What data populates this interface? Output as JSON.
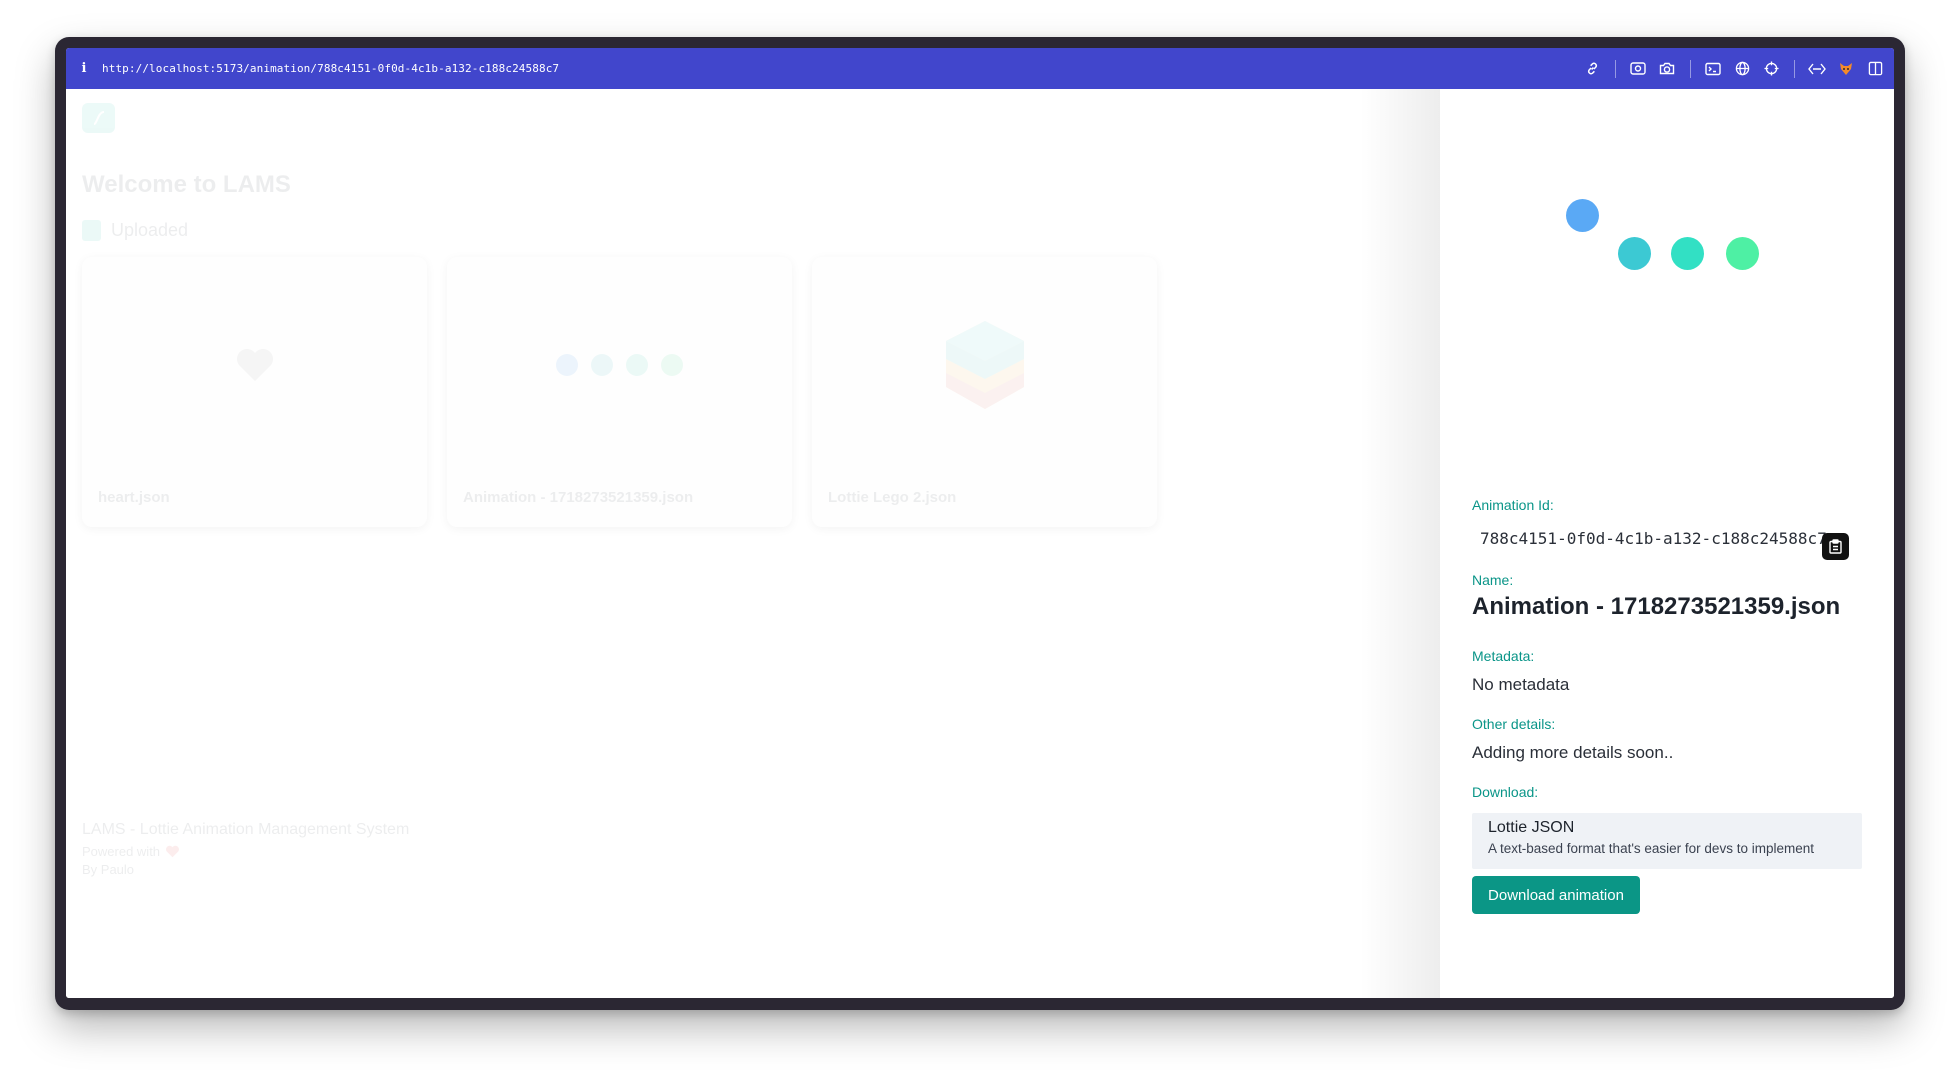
{
  "browser": {
    "info_glyph": "i",
    "url": "http://localhost:5173/animation/788c4151-0f0d-4c1b-a132-c188c24588c7"
  },
  "background_page": {
    "title": "Welcome to LAMS",
    "section_label": "Uploaded",
    "cards": [
      {
        "filename": "heart.json",
        "preview": "heart"
      },
      {
        "filename": "Animation - 1718273521359.json",
        "preview": "dots"
      },
      {
        "filename": "Lottie Lego 2.json",
        "preview": "lego"
      }
    ],
    "footer": {
      "line1": "LAMS - Lottie Animation Management System",
      "powered": "Powered with",
      "author": "By Paulo"
    }
  },
  "drawer": {
    "animation_id_label": "Animation Id:",
    "animation_id": "788c4151-0f0d-4c1b-a132-c188c24588c7",
    "name_label": "Name:",
    "name": "Animation - 1718273521359.json",
    "metadata_label": "Metadata:",
    "metadata": "No metadata",
    "other_label": "Other details:",
    "other": "Adding more details soon..",
    "download_label": "Download:",
    "download_option": {
      "title": "Lottie JSON",
      "description": "A text-based format that's easier for devs to implement"
    },
    "download_button": "Download animation"
  },
  "colors": {
    "accent": "#0b9686",
    "browser_bar": "#4146cc",
    "dot_blue": "#5aa9f5",
    "dot_teal": "#3cc9d3",
    "dot_aqua": "#32e0c4",
    "dot_green": "#4ef0a4"
  }
}
